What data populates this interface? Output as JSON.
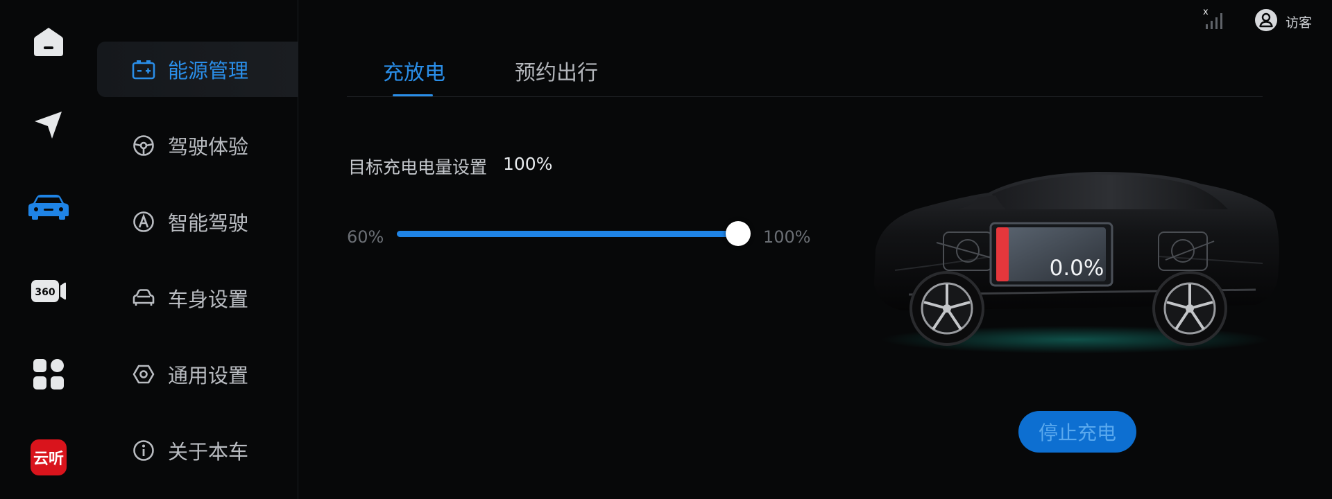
{
  "rail": {
    "items": [
      {
        "name": "home",
        "active": false
      },
      {
        "name": "navigation",
        "active": false
      },
      {
        "name": "vehicle",
        "active": true
      },
      {
        "name": "camera-360",
        "active": false,
        "label": "360"
      },
      {
        "name": "apps",
        "active": false
      },
      {
        "name": "music",
        "active": false,
        "label": "云听"
      }
    ]
  },
  "menu": {
    "items": [
      {
        "label": "能源管理",
        "icon": "battery-icon",
        "active": true
      },
      {
        "label": "驾驶体验",
        "icon": "steering-wheel-icon",
        "active": false
      },
      {
        "label": "智能驾驶",
        "icon": "autopilot-icon",
        "active": false
      },
      {
        "label": "车身设置",
        "icon": "car-body-icon",
        "active": false
      },
      {
        "label": "通用设置",
        "icon": "hex-nut-icon",
        "active": false
      },
      {
        "label": "关于本车",
        "icon": "info-icon",
        "active": false
      }
    ]
  },
  "tabs": [
    {
      "label": "充放电",
      "active": true
    },
    {
      "label": "预约出行",
      "active": false
    }
  ],
  "charge_target": {
    "label": "目标充电电量设置",
    "value": "100%",
    "min_label": "60%",
    "max_label": "100%",
    "slider_fraction": 1.0
  },
  "status": {
    "signal_badge": "x",
    "user_label": "访客"
  },
  "battery": {
    "percent_text": "0.0%"
  },
  "stop_button": {
    "label": "停止充电"
  },
  "colors": {
    "accent": "#2a8ee8",
    "background": "#070809",
    "battery_low": "#e5373c"
  }
}
